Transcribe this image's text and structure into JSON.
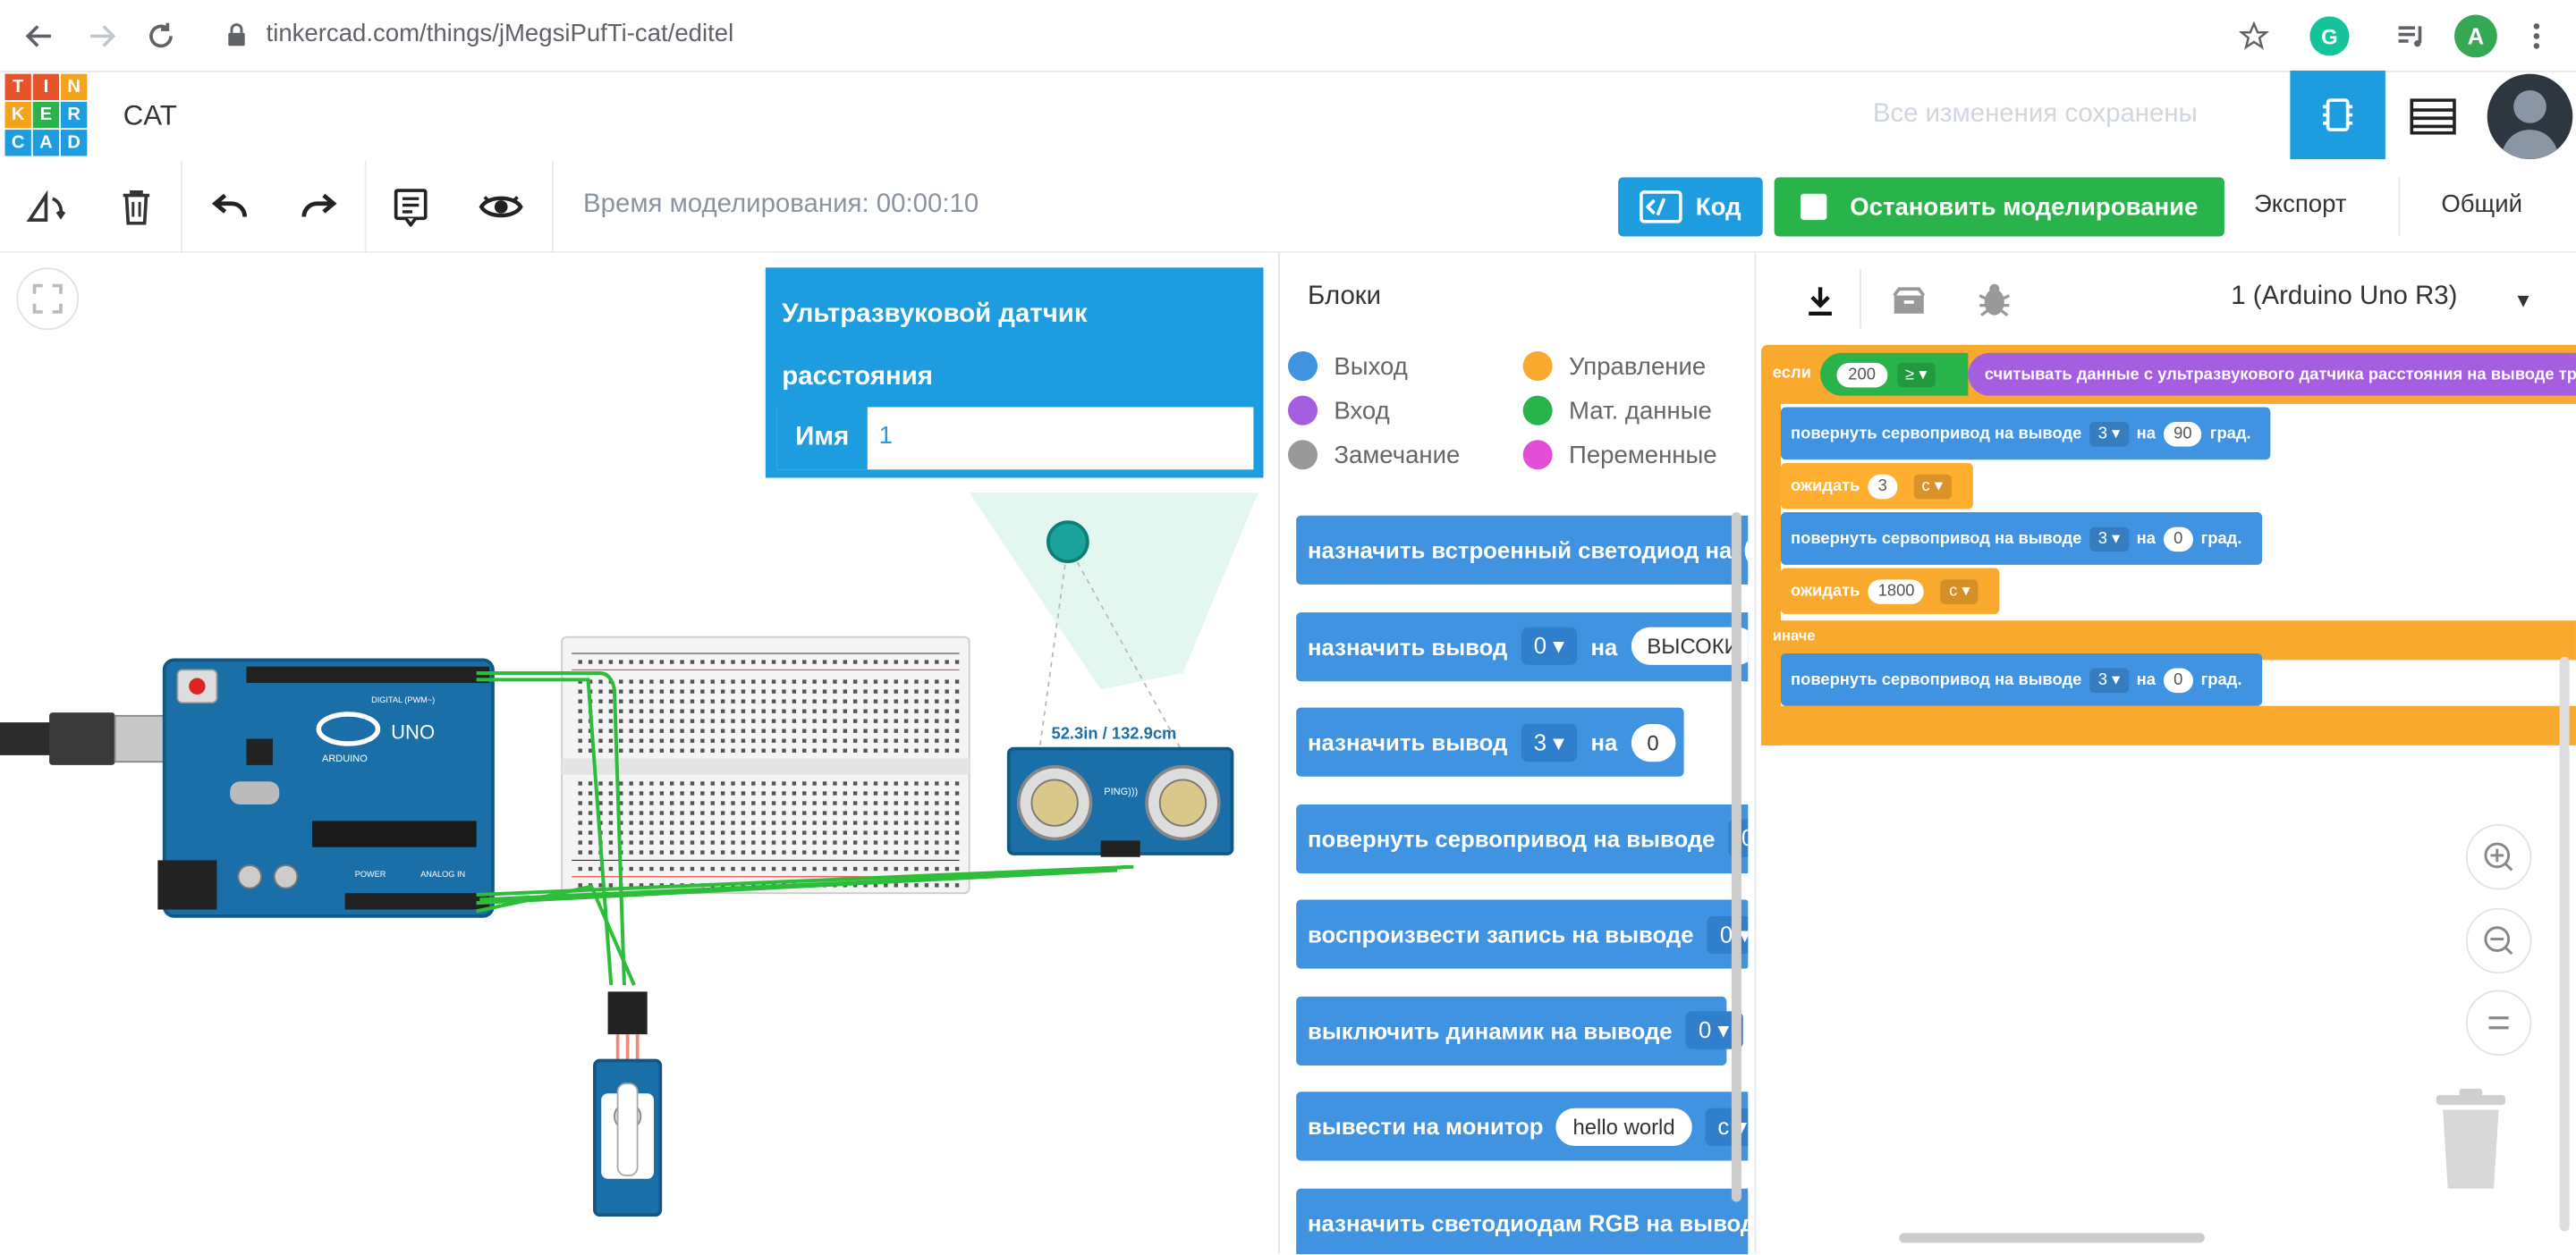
{
  "browser": {
    "url": "tinkercad.com/things/jMegsiPufTi-cat/editel",
    "account_initial": "A",
    "extension_icon": "G"
  },
  "header": {
    "logo_letters": [
      "T",
      "I",
      "N",
      "K",
      "E",
      "R",
      "C",
      "A",
      "D"
    ],
    "logo_colors": [
      "#e8542a",
      "#e8542a",
      "#f4a31a",
      "#f4a31a",
      "#28b34b",
      "#1d9de0",
      "#1d9de0",
      "#1d9de0",
      "#1d9de0"
    ],
    "title": "CAT",
    "saved_status": "Все изменения сохранены"
  },
  "toolbar": {
    "sim_time": "Время моделирования: 00:00:10",
    "code_label": "Код",
    "stop_label": "Остановить моделирование",
    "export_label": "Экспорт",
    "share_label": "Общий"
  },
  "popup": {
    "title": "Ультразвуковой датчик расстояния",
    "name_label": "Имя",
    "name_value": "1"
  },
  "sensor": {
    "readout": "52.3in / 132.9cm",
    "module_label": "PING)))"
  },
  "arduino": {
    "model": "UNO",
    "brand": "ARDUINO",
    "digital_label": "DIGITAL (PWM~)",
    "power_label": "POWER",
    "analog_label": "ANALOG IN"
  },
  "code_panel": {
    "blocks_header": "Блоки",
    "board_select": "1 (Arduino Uno R3)",
    "categories": [
      {
        "label": "Выход",
        "color": "#3f93e0"
      },
      {
        "label": "Управление",
        "color": "#f9a92e"
      },
      {
        "label": "Вход",
        "color": "#a55ee0"
      },
      {
        "label": "Мат. данные",
        "color": "#28b34b"
      },
      {
        "label": "Замечание",
        "color": "#999999"
      },
      {
        "label": "Переменные",
        "color": "#e24fd6"
      }
    ],
    "palette": [
      {
        "text": "назначить встроенный светодиод на",
        "extra": "В"
      },
      {
        "text": "назначить вывод",
        "dd": "0",
        "mid": "на",
        "extra": "ВЫСОКИ"
      },
      {
        "text": "назначить вывод",
        "dd": "3",
        "mid": "на",
        "pill": "0"
      },
      {
        "text": "повернуть сервопривод на выводе",
        "dd": "0"
      },
      {
        "text": "воспроизвести запись на выводе",
        "dd": "0"
      },
      {
        "text": "выключить динамик на выводе",
        "dd": "0"
      },
      {
        "text": "вывести на монитор",
        "pill": "hello world",
        "dd": "с"
      },
      {
        "text": "назначить светодиодам RGB на выводах"
      }
    ]
  },
  "script": {
    "if_label": "если",
    "compare_value": "200",
    "compare_op": "≥",
    "sensor_block": "считывать данные с ультразвукового датчика расстояния на выводе триг",
    "servo1": {
      "text": "повернуть сервопривод на выводе",
      "pin": "3",
      "on": "на",
      "value": "90",
      "unit": "град."
    },
    "wait1": {
      "text": "ожидать",
      "value": "3",
      "unit": "с"
    },
    "servo2": {
      "text": "повернуть сервопривод на выводе",
      "pin": "3",
      "on": "на",
      "value": "0",
      "unit": "град."
    },
    "wait2": {
      "text": "ожидать",
      "value": "1800",
      "unit": "с"
    },
    "else_label": "иначе",
    "servo3": {
      "text": "повернуть сервопривод на выводе",
      "pin": "3",
      "on": "на",
      "value": "0",
      "unit": "град."
    }
  }
}
